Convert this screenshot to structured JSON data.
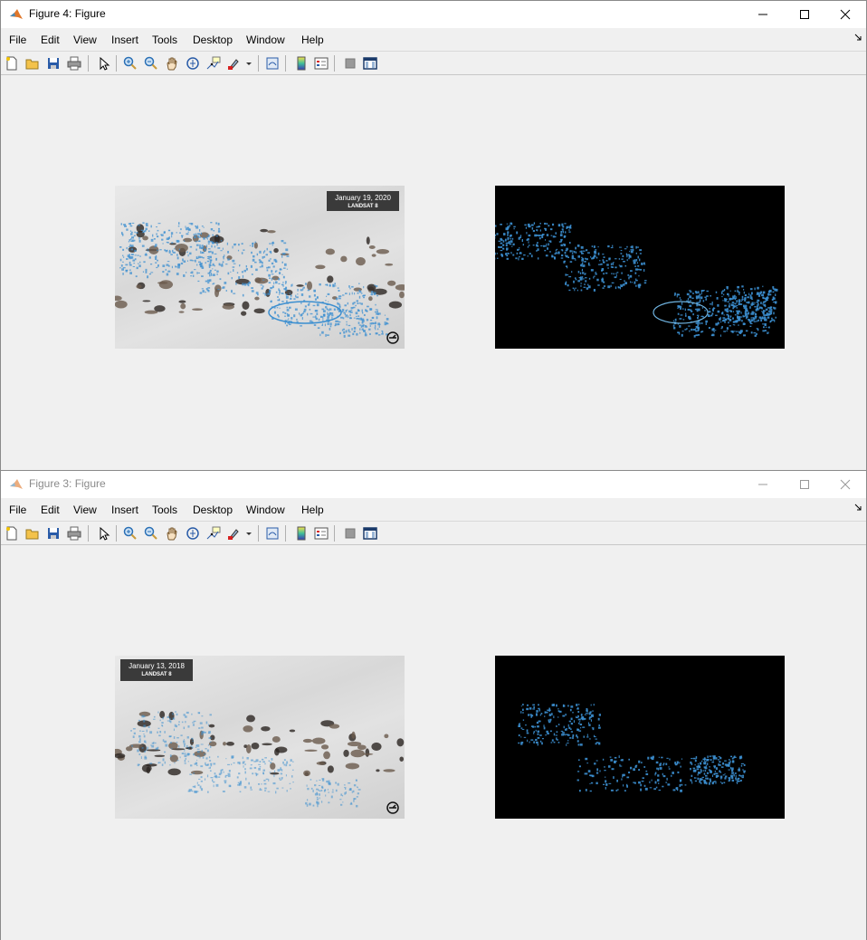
{
  "menu": [
    "File",
    "Edit",
    "View",
    "Insert",
    "Tools",
    "Desktop",
    "Window",
    "Help"
  ],
  "windows": [
    {
      "title": "Figure 4: Figure",
      "active": true,
      "image_left": {
        "date": "January 19, 2020",
        "satellite": "LANDSAT 8"
      }
    },
    {
      "title": "Figure 3: Figure",
      "active": false,
      "image_left": {
        "date": "January 13, 2018",
        "satellite": "LANDSAT 8"
      }
    }
  ],
  "colors": {
    "meltwater": "#3c8fd0",
    "mask_bg": "#000000",
    "stamp_bg": "#3a3a3a",
    "matlab_orange": "#e0772a"
  },
  "toolbar_icons": [
    "new-figure-icon",
    "open-file-icon",
    "save-figure-icon",
    "print-figure-icon",
    "edit-plot-icon",
    "zoom-in-icon",
    "zoom-out-icon",
    "pan-icon",
    "rotate-3d-icon",
    "data-cursor-icon",
    "brush-icon",
    "link-plot-icon",
    "insert-colorbar-icon",
    "insert-legend-icon",
    "hide-plot-tools-icon",
    "show-plot-tools-icon"
  ]
}
